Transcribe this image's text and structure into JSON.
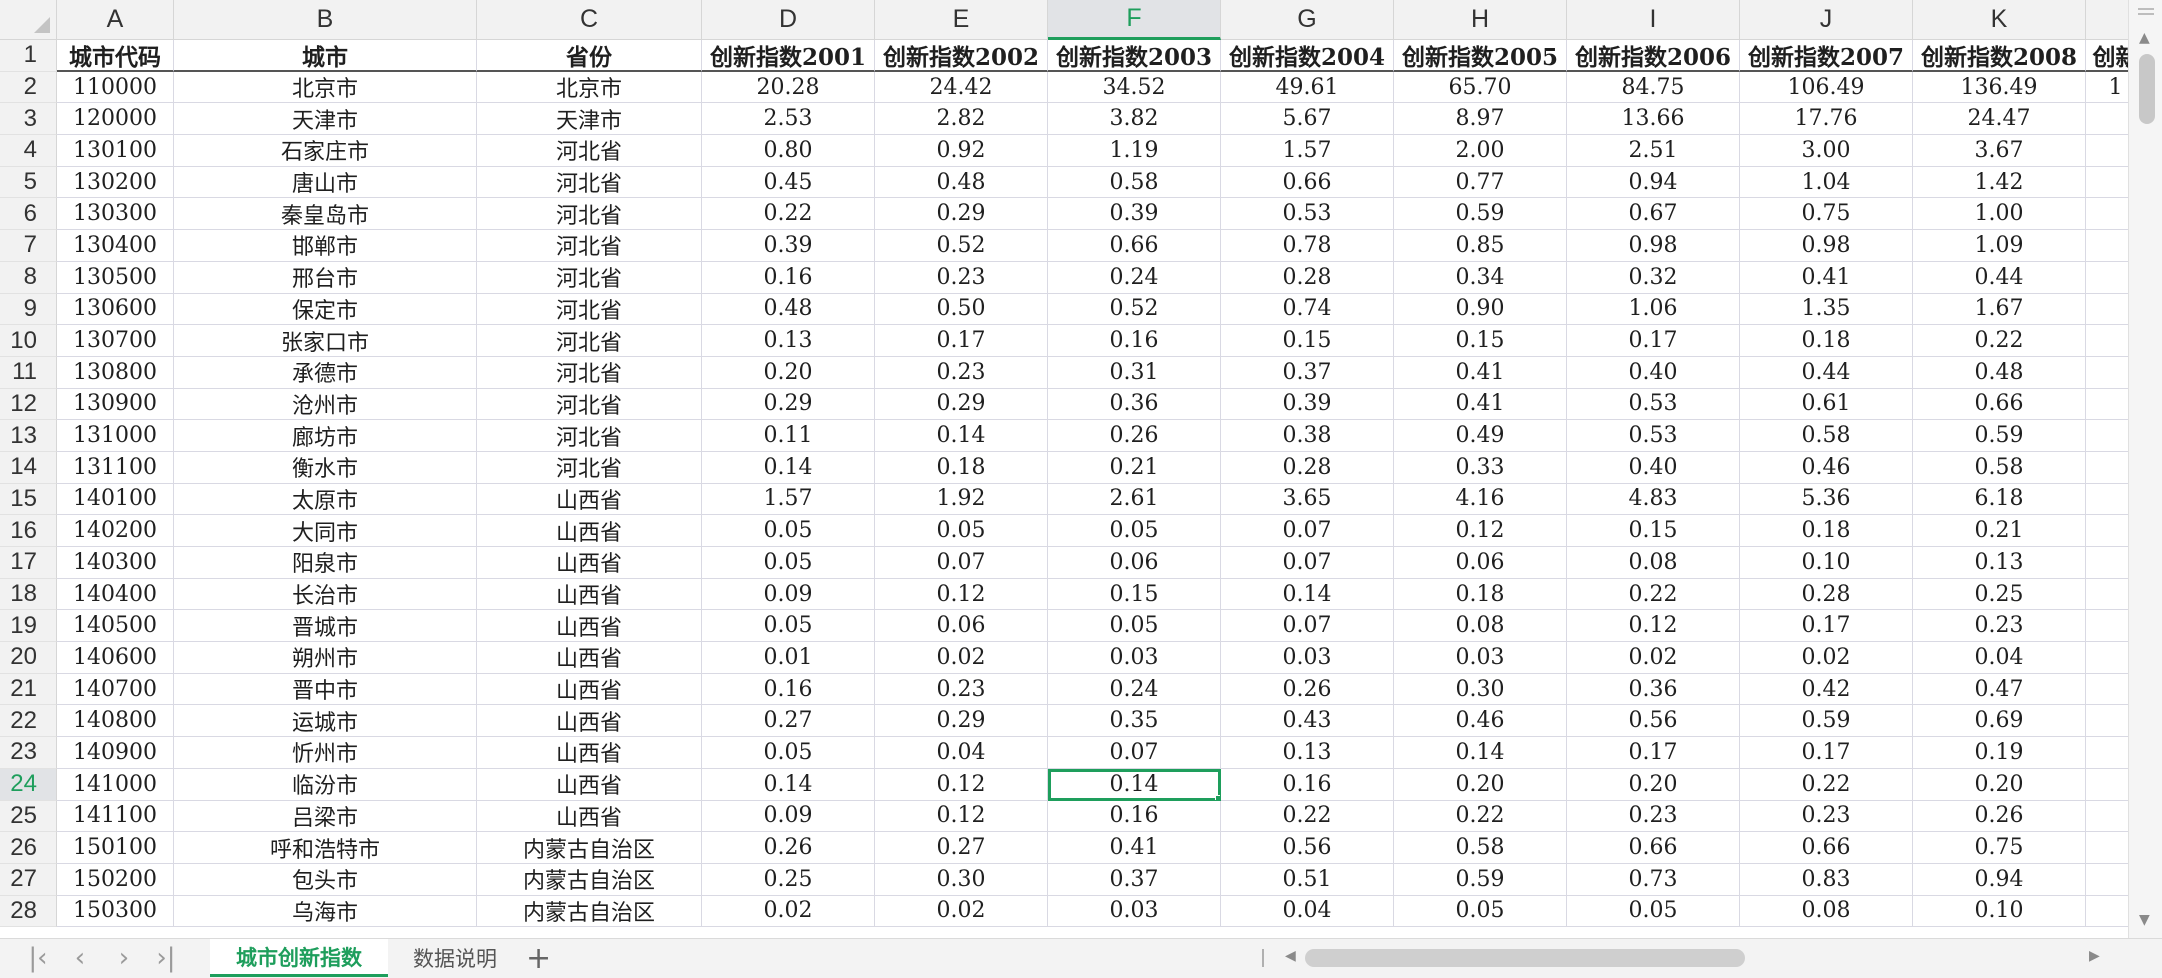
{
  "columns": [
    {
      "letter": "A",
      "width": 117
    },
    {
      "letter": "B",
      "width": 303
    },
    {
      "letter": "C",
      "width": 225
    },
    {
      "letter": "D",
      "width": 173
    },
    {
      "letter": "E",
      "width": 173
    },
    {
      "letter": "F",
      "width": 173
    },
    {
      "letter": "G",
      "width": 173
    },
    {
      "letter": "H",
      "width": 173
    },
    {
      "letter": "I",
      "width": 173
    },
    {
      "letter": "J",
      "width": 173
    },
    {
      "letter": "K",
      "width": 173
    },
    {
      "letter": "",
      "width": 60
    }
  ],
  "active_column": "F",
  "active_row": "24",
  "selected_cell": {
    "row": 23,
    "col": 5
  },
  "row_numbers": [
    "1",
    "2",
    "3",
    "4",
    "5",
    "6",
    "7",
    "8",
    "9",
    "10",
    "11",
    "12",
    "13",
    "14",
    "15",
    "16",
    "17",
    "18",
    "19",
    "20",
    "21",
    "22",
    "23",
    "24",
    "25",
    "26",
    "27",
    "28"
  ],
  "rows": [
    [
      "城市代码",
      "城市",
      "省份",
      "创新指数2001",
      "创新指数2002",
      "创新指数2003",
      "创新指数2004",
      "创新指数2005",
      "创新指数2006",
      "创新指数2007",
      "创新指数2008",
      "创新"
    ],
    [
      "110000",
      "北京市",
      "北京市",
      "20.28",
      "24.42",
      "34.52",
      "49.61",
      "65.70",
      "84.75",
      "106.49",
      "136.49",
      "1"
    ],
    [
      "120000",
      "天津市",
      "天津市",
      "2.53",
      "2.82",
      "3.82",
      "5.67",
      "8.97",
      "13.66",
      "17.76",
      "24.47",
      ""
    ],
    [
      "130100",
      "石家庄市",
      "河北省",
      "0.80",
      "0.92",
      "1.19",
      "1.57",
      "2.00",
      "2.51",
      "3.00",
      "3.67",
      ""
    ],
    [
      "130200",
      "唐山市",
      "河北省",
      "0.45",
      "0.48",
      "0.58",
      "0.66",
      "0.77",
      "0.94",
      "1.04",
      "1.42",
      ""
    ],
    [
      "130300",
      "秦皇岛市",
      "河北省",
      "0.22",
      "0.29",
      "0.39",
      "0.53",
      "0.59",
      "0.67",
      "0.75",
      "1.00",
      ""
    ],
    [
      "130400",
      "邯郸市",
      "河北省",
      "0.39",
      "0.52",
      "0.66",
      "0.78",
      "0.85",
      "0.98",
      "0.98",
      "1.09",
      ""
    ],
    [
      "130500",
      "邢台市",
      "河北省",
      "0.16",
      "0.23",
      "0.24",
      "0.28",
      "0.34",
      "0.32",
      "0.41",
      "0.44",
      ""
    ],
    [
      "130600",
      "保定市",
      "河北省",
      "0.48",
      "0.50",
      "0.52",
      "0.74",
      "0.90",
      "1.06",
      "1.35",
      "1.67",
      ""
    ],
    [
      "130700",
      "张家口市",
      "河北省",
      "0.13",
      "0.17",
      "0.16",
      "0.15",
      "0.15",
      "0.17",
      "0.18",
      "0.22",
      ""
    ],
    [
      "130800",
      "承德市",
      "河北省",
      "0.20",
      "0.23",
      "0.31",
      "0.37",
      "0.41",
      "0.40",
      "0.44",
      "0.48",
      ""
    ],
    [
      "130900",
      "沧州市",
      "河北省",
      "0.29",
      "0.29",
      "0.36",
      "0.39",
      "0.41",
      "0.53",
      "0.61",
      "0.66",
      ""
    ],
    [
      "131000",
      "廊坊市",
      "河北省",
      "0.11",
      "0.14",
      "0.26",
      "0.38",
      "0.49",
      "0.53",
      "0.58",
      "0.59",
      ""
    ],
    [
      "131100",
      "衡水市",
      "河北省",
      "0.14",
      "0.18",
      "0.21",
      "0.28",
      "0.33",
      "0.40",
      "0.46",
      "0.58",
      ""
    ],
    [
      "140100",
      "太原市",
      "山西省",
      "1.57",
      "1.92",
      "2.61",
      "3.65",
      "4.16",
      "4.83",
      "5.36",
      "6.18",
      ""
    ],
    [
      "140200",
      "大同市",
      "山西省",
      "0.05",
      "0.05",
      "0.05",
      "0.07",
      "0.12",
      "0.15",
      "0.18",
      "0.21",
      ""
    ],
    [
      "140300",
      "阳泉市",
      "山西省",
      "0.05",
      "0.07",
      "0.06",
      "0.07",
      "0.06",
      "0.08",
      "0.10",
      "0.13",
      ""
    ],
    [
      "140400",
      "长治市",
      "山西省",
      "0.09",
      "0.12",
      "0.15",
      "0.14",
      "0.18",
      "0.22",
      "0.28",
      "0.25",
      ""
    ],
    [
      "140500",
      "晋城市",
      "山西省",
      "0.05",
      "0.06",
      "0.05",
      "0.07",
      "0.08",
      "0.12",
      "0.17",
      "0.23",
      ""
    ],
    [
      "140600",
      "朔州市",
      "山西省",
      "0.01",
      "0.02",
      "0.03",
      "0.03",
      "0.03",
      "0.02",
      "0.02",
      "0.04",
      ""
    ],
    [
      "140700",
      "晋中市",
      "山西省",
      "0.16",
      "0.23",
      "0.24",
      "0.26",
      "0.30",
      "0.36",
      "0.42",
      "0.47",
      ""
    ],
    [
      "140800",
      "运城市",
      "山西省",
      "0.27",
      "0.29",
      "0.35",
      "0.43",
      "0.46",
      "0.56",
      "0.59",
      "0.69",
      ""
    ],
    [
      "140900",
      "忻州市",
      "山西省",
      "0.05",
      "0.04",
      "0.07",
      "0.13",
      "0.14",
      "0.17",
      "0.17",
      "0.19",
      ""
    ],
    [
      "141000",
      "临汾市",
      "山西省",
      "0.14",
      "0.12",
      "0.14",
      "0.16",
      "0.20",
      "0.20",
      "0.22",
      "0.20",
      ""
    ],
    [
      "141100",
      "吕梁市",
      "山西省",
      "0.09",
      "0.12",
      "0.16",
      "0.22",
      "0.22",
      "0.23",
      "0.23",
      "0.26",
      ""
    ],
    [
      "150100",
      "呼和浩特市",
      "内蒙古自治区",
      "0.26",
      "0.27",
      "0.41",
      "0.56",
      "0.58",
      "0.66",
      "0.66",
      "0.75",
      ""
    ],
    [
      "150200",
      "包头市",
      "内蒙古自治区",
      "0.25",
      "0.30",
      "0.37",
      "0.51",
      "0.59",
      "0.73",
      "0.83",
      "0.94",
      ""
    ],
    [
      "150300",
      "乌海市",
      "内蒙古自治区",
      "0.02",
      "0.02",
      "0.03",
      "0.04",
      "0.05",
      "0.05",
      "0.08",
      "0.10",
      ""
    ]
  ],
  "sheet_tabs": [
    {
      "label": "城市创新指数",
      "active": true
    },
    {
      "label": "数据说明",
      "active": false
    }
  ],
  "nav": {
    "first": "|‹",
    "prev": "‹",
    "next": "›",
    "last": "›|",
    "add": "+"
  },
  "colors": {
    "accent": "#1e9e5c",
    "header_bg": "#f2f2f2",
    "grid_line": "#d9d9e3"
  }
}
